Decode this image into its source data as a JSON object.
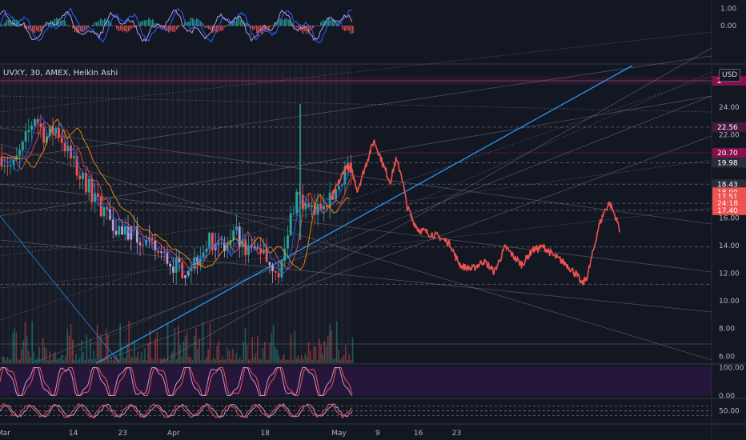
{
  "symbol": {
    "ticker": "UVXY",
    "interval": "30",
    "exchange": "AMEX",
    "chart_style": "Heikin Ashi",
    "currency": "USD"
  },
  "colors": {
    "background": "#131722",
    "up": "#26a69a",
    "down": "#ef5350",
    "purple": "#b39ddb",
    "trendline": "#2196f3",
    "grid": "#2a2e39",
    "text": "#b2b5be"
  },
  "chart_data": [
    {
      "type": "line",
      "pane": "top-oscillator",
      "y_ticks": [
        "1.00",
        "0.00"
      ],
      "ylim": [
        -1.2,
        1.5
      ]
    },
    {
      "type": "candlestick",
      "pane": "price",
      "x_ticks": [
        {
          "label": "Mar",
          "day": 0
        },
        {
          "label": "14",
          "day": 13
        },
        {
          "label": "23",
          "day": 22
        },
        {
          "label": "Apr",
          "day": 31
        },
        {
          "label": "18",
          "day": 48
        },
        {
          "label": "May",
          "day": 61
        },
        {
          "label": "9",
          "day": 69
        },
        {
          "label": "16",
          "day": 76
        },
        {
          "label": "23",
          "day": 83
        }
      ],
      "y_ticks": [
        "24.00",
        "22.00",
        "18.00",
        "16.00",
        "14.00",
        "12.00",
        "10.00",
        "8.00",
        "6.00"
      ],
      "ylim": [
        5.5,
        27
      ],
      "price_path": [
        [
          0,
          20.4
        ],
        [
          2,
          19.6
        ],
        [
          4,
          21.2
        ],
        [
          6,
          23.4
        ],
        [
          8,
          21.8
        ],
        [
          10,
          22.5
        ],
        [
          12,
          20.8
        ],
        [
          14,
          19.2
        ],
        [
          16,
          18.1
        ],
        [
          17,
          17.2
        ],
        [
          19,
          16.5
        ],
        [
          21,
          15.4
        ],
        [
          23,
          15.0
        ],
        [
          25,
          14.5
        ],
        [
          27,
          13.9
        ],
        [
          29,
          13.4
        ],
        [
          31,
          12.7
        ],
        [
          33,
          12.3
        ],
        [
          35,
          12.8
        ],
        [
          37,
          14.0
        ],
        [
          39,
          14.5
        ],
        [
          41,
          13.6
        ],
        [
          43,
          14.8
        ],
        [
          45,
          13.4
        ],
        [
          47,
          14.0
        ],
        [
          49,
          12.7
        ],
        [
          51,
          12.3
        ],
        [
          52,
          14.0
        ],
        [
          53,
          16.5
        ],
        [
          54,
          17.9
        ],
        [
          55,
          17.0
        ],
        [
          57,
          16.2
        ],
        [
          59,
          17.5
        ],
        [
          60,
          17.2
        ],
        [
          62,
          18.9
        ],
        [
          63,
          19.8
        ],
        [
          64,
          19.3
        ],
        [
          65,
          18.0
        ],
        [
          67,
          20.4
        ],
        [
          68,
          21.6
        ],
        [
          69,
          20.6
        ],
        [
          70,
          19.5
        ],
        [
          71,
          18.6
        ],
        [
          72,
          20.2
        ],
        [
          73,
          19.2
        ],
        [
          74,
          16.9
        ],
        [
          75,
          15.9
        ],
        [
          76,
          15.2
        ],
        [
          78,
          14.9
        ],
        [
          80,
          14.6
        ],
        [
          82,
          14.1
        ],
        [
          83,
          13.1
        ],
        [
          84,
          12.5
        ],
        [
          86,
          12.3
        ],
        [
          88,
          12.9
        ],
        [
          90,
          12.1
        ],
        [
          92,
          13.9
        ],
        [
          94,
          13.0
        ],
        [
          95,
          12.6
        ],
        [
          97,
          13.7
        ],
        [
          99,
          13.9
        ],
        [
          101,
          13.2
        ],
        [
          103,
          12.7
        ],
        [
          105,
          11.9
        ],
        [
          106,
          11.2
        ],
        [
          107,
          11.8
        ],
        [
          108,
          13.5
        ],
        [
          109,
          15.3
        ],
        [
          110,
          16.4
        ],
        [
          111,
          17.1
        ],
        [
          112,
          16.2
        ],
        [
          113,
          15.1
        ]
      ],
      "horizontal_levels": [
        "22.56",
        "20.70",
        "19.98",
        "18.43",
        "17.51",
        "17.40"
      ],
      "price_labels": [
        {
          "text": "2",
          "value": 25.9,
          "color": "#880e4f"
        },
        {
          "text": "22.56",
          "value": 22.56,
          "color": "#4a1942"
        },
        {
          "text": "20.70",
          "value": 20.7,
          "color": "#880e4f"
        },
        {
          "text": "19.98",
          "value": 19.98,
          "color": "#2a2e39"
        },
        {
          "text": "18.43",
          "value": 18.43,
          "color": "#2a2e39"
        },
        {
          "text": "18.00",
          "value": 17.85,
          "color": "#ef5350"
        },
        {
          "text": "17.51",
          "value": 17.51,
          "color": "#ef5350"
        },
        {
          "text": "24:18",
          "value": 17.05,
          "color": "#ef5350"
        },
        {
          "text": "17.40",
          "value": 16.55,
          "color": "#ef5350"
        }
      ]
    },
    {
      "type": "area",
      "pane": "stochastic-rsi",
      "y_ticks": [
        "100.00",
        "0.00"
      ],
      "ylim": [
        -10,
        110
      ]
    },
    {
      "type": "line",
      "pane": "bottom-oscillator",
      "y_ticks": [
        "50.00"
      ],
      "ylim": [
        0,
        100
      ]
    }
  ]
}
